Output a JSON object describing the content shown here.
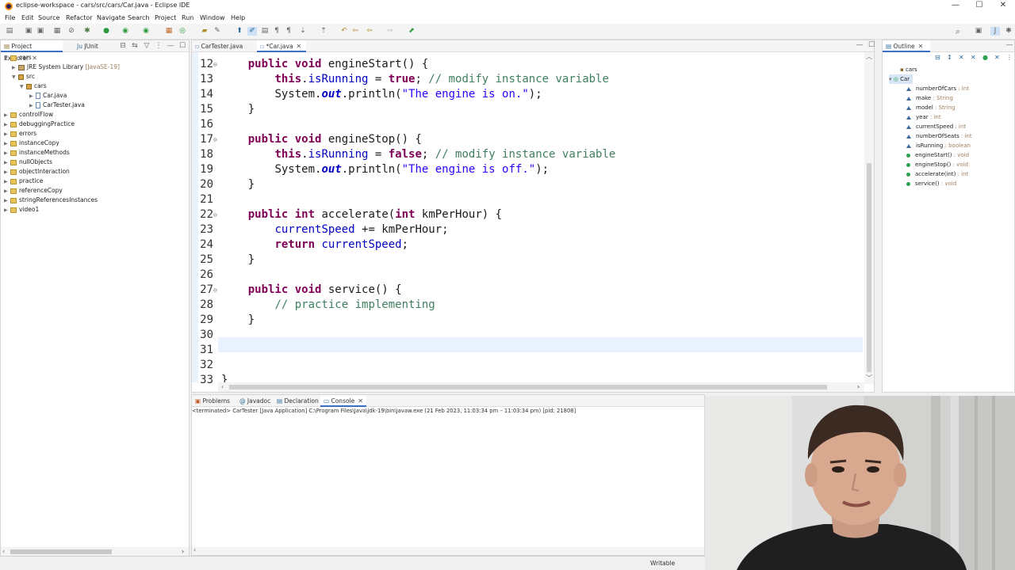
{
  "window": {
    "title": "eclipse-workspace - cars/src/cars/Car.java - Eclipse IDE",
    "minimize": "—",
    "maximize": "☐",
    "close": "✕"
  },
  "menu": [
    "File",
    "Edit",
    "Source",
    "Refactor",
    "Navigate",
    "Search",
    "Project",
    "Run",
    "Window",
    "Help"
  ],
  "explorer": {
    "tabs": [
      "Project Explorer",
      "JUnit"
    ],
    "tree": [
      {
        "label": "cars",
        "suffix": ""
      },
      {
        "label": "JRE System Library",
        "suffix": "[JavaSE-19]"
      },
      {
        "label": "src",
        "suffix": ""
      },
      {
        "label": "cars",
        "suffix": ""
      },
      {
        "label": "Car.java",
        "suffix": ""
      },
      {
        "label": "CarTester.java",
        "suffix": ""
      },
      {
        "label": "controlFlow",
        "suffix": ""
      },
      {
        "label": "debuggingPractice",
        "suffix": ""
      },
      {
        "label": "errors",
        "suffix": ""
      },
      {
        "label": "instanceCopy",
        "suffix": ""
      },
      {
        "label": "instanceMethods",
        "suffix": ""
      },
      {
        "label": "nullObjects",
        "suffix": ""
      },
      {
        "label": "objectInteraction",
        "suffix": ""
      },
      {
        "label": "practice",
        "suffix": ""
      },
      {
        "label": "referenceCopy",
        "suffix": ""
      },
      {
        "label": "stringReferencesInstances",
        "suffix": ""
      },
      {
        "label": "video1",
        "suffix": ""
      }
    ]
  },
  "editor": {
    "tabs": [
      "CarTester.java",
      "*Car.java"
    ],
    "lines": [
      {
        "n": "12",
        "fold": "⊖"
      },
      {
        "n": "13"
      },
      {
        "n": "14"
      },
      {
        "n": "15"
      },
      {
        "n": "16"
      },
      {
        "n": "17",
        "fold": "⊖"
      },
      {
        "n": "18"
      },
      {
        "n": "19"
      },
      {
        "n": "20"
      },
      {
        "n": "21"
      },
      {
        "n": "22",
        "fold": "⊖"
      },
      {
        "n": "23"
      },
      {
        "n": "24"
      },
      {
        "n": "25"
      },
      {
        "n": "26"
      },
      {
        "n": "27",
        "fold": "⊖"
      },
      {
        "n": "28"
      },
      {
        "n": "29"
      },
      {
        "n": "30"
      },
      {
        "n": "31"
      },
      {
        "n": "32"
      },
      {
        "n": "33"
      }
    ],
    "code": {
      "l12": {
        "a": "public",
        "b": "void",
        "c": " engineStart() {"
      },
      "l13": {
        "a": "this",
        "b": ".",
        "c": "isRunning",
        "d": " = ",
        "e": "true",
        "f": "; ",
        "g": "// modify instance variable"
      },
      "l14": {
        "a": "System.",
        "b": "out",
        "c": ".println(",
        "d": "\"The engine is on.\"",
        "e": ");"
      },
      "l15": "}",
      "l17": {
        "a": "public",
        "b": "void",
        "c": " engineStop() {"
      },
      "l18": {
        "a": "this",
        "b": ".",
        "c": "isRunning",
        "d": " = ",
        "e": "false",
        "f": "; ",
        "g": "// modify instance variable"
      },
      "l19": {
        "a": "System.",
        "b": "out",
        "c": ".println(",
        "d": "\"The engine is off.\"",
        "e": ");"
      },
      "l20": "}",
      "l22": {
        "a": "public",
        "b": "int",
        "c": " accelerate(",
        "d": "int",
        "e": " kmPerHour) {"
      },
      "l23": {
        "a": "currentSpeed",
        "b": " += kmPerHour;"
      },
      "l24": {
        "a": "return",
        "b": " ",
        "c": "currentSpeed",
        "d": ";"
      },
      "l25": "}",
      "l27": {
        "a": "public",
        "b": "void",
        "c": " service() {"
      },
      "l28": "// practice implementing",
      "l29": "}",
      "l33": "}"
    }
  },
  "outline": {
    "tab": "Outline",
    "package": "cars",
    "class": "Car",
    "members": [
      {
        "name": "numberOfCars",
        "type": " : int",
        "kind": "field-static"
      },
      {
        "name": "make",
        "type": " : String",
        "kind": "field"
      },
      {
        "name": "model",
        "type": " : String",
        "kind": "field"
      },
      {
        "name": "year",
        "type": " : int",
        "kind": "field"
      },
      {
        "name": "currentSpeed",
        "type": " : int",
        "kind": "field"
      },
      {
        "name": "numberOfSeats",
        "type": " : int",
        "kind": "field"
      },
      {
        "name": "isRunning",
        "type": " : boolean",
        "kind": "field"
      },
      {
        "name": "engineStart()",
        "type": " : void",
        "kind": "method"
      },
      {
        "name": "engineStop()",
        "type": " : void",
        "kind": "method"
      },
      {
        "name": "accelerate(int)",
        "type": " : int",
        "kind": "method"
      },
      {
        "name": "service()",
        "type": " : void",
        "kind": "method"
      }
    ]
  },
  "console": {
    "tabs": [
      "Problems",
      "Javadoc",
      "Declaration",
      "Console"
    ],
    "terminated": "<terminated> CarTester [Java Application] C:\\Program Files\\Java\\jdk-19\\bin\\javaw.exe  (21 Feb 2023, 11:03:34 pm – 11:03:34 pm) [pid: 21808]"
  },
  "status": {
    "mode": "Writable"
  },
  "colors": {
    "keyword": "#7f0055",
    "comment": "#3f7f5f",
    "string": "#2a00ff",
    "field": "#0000c0",
    "highlight": "#e8f2fe"
  }
}
